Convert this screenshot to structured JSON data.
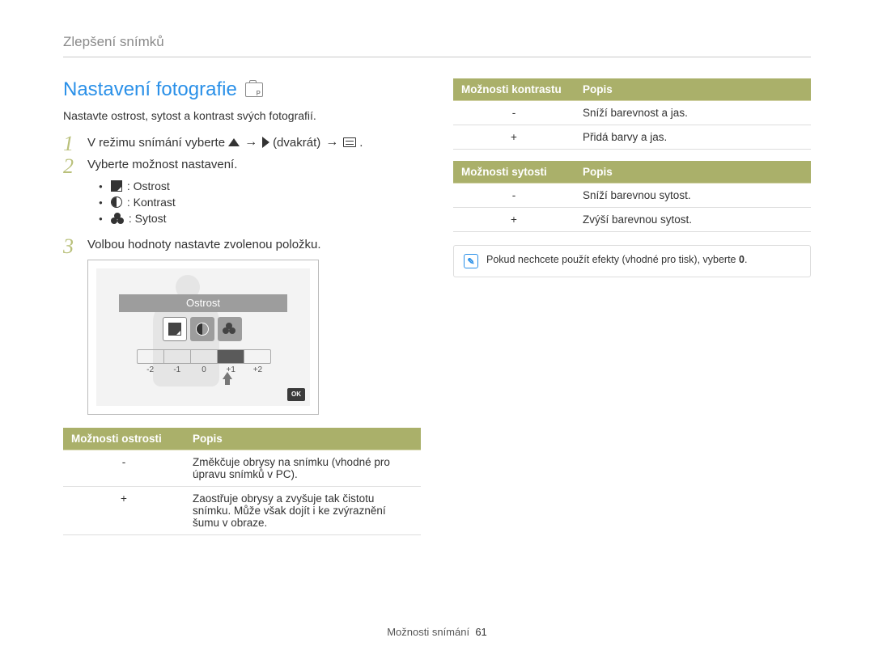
{
  "breadcrumb": "Zlepšení snímků",
  "title": "Nastavení fotografie",
  "subtitle": "Nastavte ostrost, sytost a kontrast svých fotografií.",
  "step1_pre": "V režimu snímání vyberte",
  "step1_twice": "(dvakrát)",
  "step1_end": ".",
  "step2": "Vyberte možnost nastavení.",
  "bullets": {
    "sharp": ": Ostrost",
    "contrast": ": Kontrast",
    "saturation": ": Sytost"
  },
  "step3": "Volbou hodnoty nastavte zvolenou položku.",
  "screen": {
    "caption": "Ostrost",
    "scale": [
      "-2",
      "-1",
      "0",
      "+1",
      "+2"
    ],
    "ok": "OK"
  },
  "tables": {
    "sharpness": {
      "h1": "Možnosti ostrosti",
      "h2": "Popis",
      "rows": [
        {
          "sign": "-",
          "desc": "Změkčuje obrysy na snímku (vhodné pro úpravu snímků v PC)."
        },
        {
          "sign": "+",
          "desc": "Zaostřuje obrysy a zvyšuje tak čistotu snímku. Může však dojít i ke zvýraznění šumu v obraze."
        }
      ]
    },
    "contrast": {
      "h1": "Možnosti kontrastu",
      "h2": "Popis",
      "rows": [
        {
          "sign": "-",
          "desc": "Sníží barevnost a jas."
        },
        {
          "sign": "+",
          "desc": "Přidá barvy a jas."
        }
      ]
    },
    "saturation": {
      "h1": "Možnosti sytosti",
      "h2": "Popis",
      "rows": [
        {
          "sign": "-",
          "desc": "Sníží barevnou sytost."
        },
        {
          "sign": "+",
          "desc": "Zvýší barevnou sytost."
        }
      ]
    }
  },
  "note_pre": "Pokud nechcete použít efekty (vhodné pro tisk), vyberte ",
  "note_bold": "0",
  "note_post": ".",
  "footer_label": "Možnosti snímání",
  "footer_page": "61"
}
